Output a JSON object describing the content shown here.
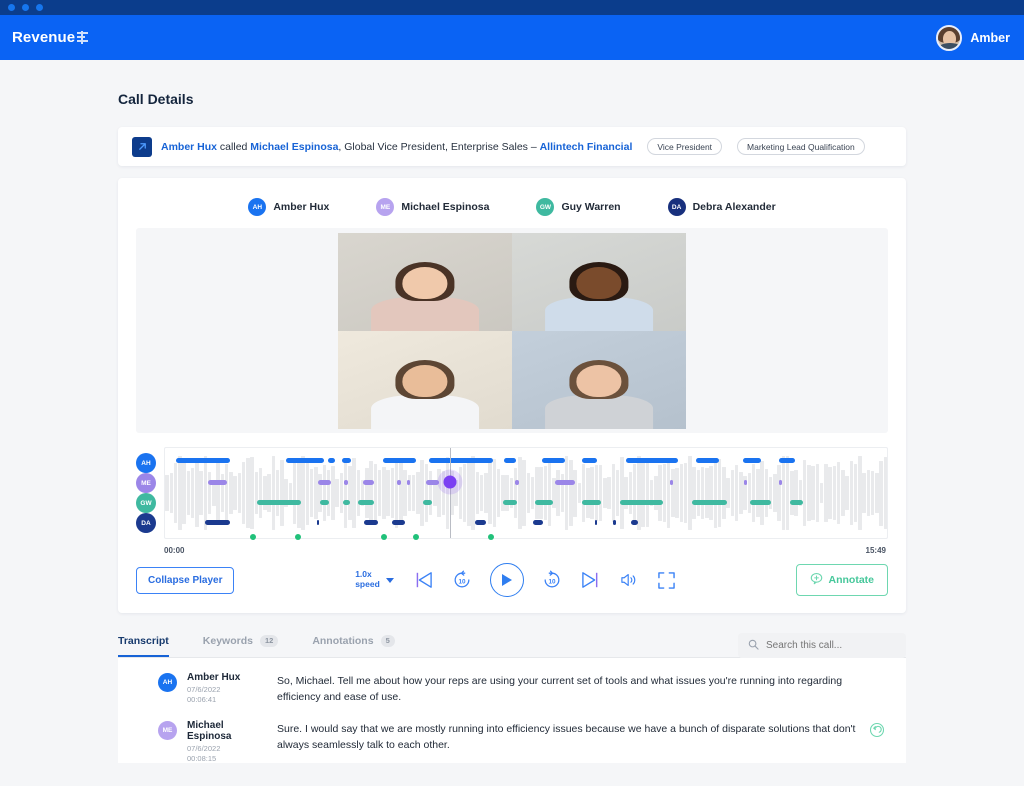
{
  "window": {
    "dots": 3
  },
  "topnav": {
    "brand": "Revenue",
    "brand_icon": "revenue-logo-mark",
    "user_name": "Amber",
    "avatar_icon": "user-avatar"
  },
  "page": {
    "title": "Call Details"
  },
  "summary": {
    "icon": "call-arrow-icon",
    "caller": "Amber Hux",
    "verb": " called ",
    "callee": "Michael Espinosa",
    "role": ", Global Vice President, Enterprise Sales – ",
    "org": "Allintech Financial",
    "tags": [
      "Vice President",
      "Marketing Lead Qualification"
    ]
  },
  "participants": [
    {
      "initials": "AH",
      "name": "Amber Hux",
      "color": "#1a73f0"
    },
    {
      "initials": "ME",
      "name": "Michael Espinosa",
      "color": "#b7a3ef"
    },
    {
      "initials": "GW",
      "name": "Guy Warren",
      "color": "#3fb9a0"
    },
    {
      "initials": "DA",
      "name": "Debra Alexander",
      "color": "#18307d"
    }
  ],
  "video_grid": {
    "tiles": [
      {
        "name": "participant-video-top-left",
        "bg": "#d9d6cf",
        "skin": "#f0c9ab",
        "hair": "#4a3326",
        "shirt": "#e3c7bd"
      },
      {
        "name": "participant-video-top-right",
        "bg": "#d7d9d6",
        "skin": "#7a4b2c",
        "hair": "#2a1a12",
        "shirt": "#cfdcea"
      },
      {
        "name": "participant-video-bottom-left",
        "bg": "#efe9dd",
        "skin": "#e9bd99",
        "hair": "#5d4634",
        "shirt": "#f4f5f7"
      },
      {
        "name": "participant-video-bottom-right",
        "bg": "#c3cfdb",
        "skin": "#edc3a5",
        "hair": "#6b513c",
        "shirt": "#cfd2d6"
      }
    ]
  },
  "timeline": {
    "start_time": "00:00",
    "end_time": "15:49",
    "playhead_percent": 39.5,
    "playhead_track": 1,
    "tracks": [
      {
        "initials": "AH",
        "color": "#1a73f0",
        "segments": [
          [
            1.5,
            7.5
          ],
          [
            16.8,
            5.2
          ],
          [
            22.6,
            1.0
          ],
          [
            24.5,
            1.2
          ],
          [
            30.2,
            4.5
          ],
          [
            36.5,
            9.0
          ],
          [
            47.0,
            1.6
          ],
          [
            52.2,
            3.2
          ],
          [
            57.8,
            2.0
          ],
          [
            63.8,
            7.2
          ],
          [
            73.5,
            3.2
          ],
          [
            80.0,
            2.6
          ],
          [
            85.0,
            2.2
          ]
        ]
      },
      {
        "initials": "ME",
        "color": "#9b86e8",
        "segments": [
          [
            6.0,
            2.6
          ],
          [
            21.2,
            1.8
          ],
          [
            24.8,
            0.5
          ],
          [
            27.4,
            1.6
          ],
          [
            32.2,
            0.5
          ],
          [
            33.5,
            0.5
          ],
          [
            36.2,
            1.8
          ],
          [
            48.5,
            0.5
          ],
          [
            54.0,
            2.8
          ],
          [
            70.0,
            0.4
          ],
          [
            80.2,
            0.4
          ],
          [
            85.0,
            0.4
          ]
        ]
      },
      {
        "initials": "GW",
        "color": "#3fb9a0",
        "segments": [
          [
            12.8,
            6.0
          ],
          [
            21.5,
            1.2
          ],
          [
            24.6,
            1.0
          ],
          [
            26.8,
            2.2
          ],
          [
            35.8,
            1.2
          ],
          [
            46.8,
            2.0
          ],
          [
            51.2,
            2.6
          ],
          [
            57.8,
            2.6
          ],
          [
            63.0,
            6.0
          ],
          [
            73.0,
            4.8
          ],
          [
            81.0,
            3.0
          ],
          [
            86.5,
            1.8
          ]
        ]
      },
      {
        "initials": "DA",
        "color": "#1b3a8f",
        "segments": [
          [
            5.5,
            3.5
          ],
          [
            21.0,
            0.4
          ],
          [
            27.5,
            2.0
          ],
          [
            31.5,
            1.8
          ],
          [
            43.0,
            1.4
          ],
          [
            51.0,
            1.4
          ],
          [
            59.5,
            0.4
          ],
          [
            62.0,
            0.4
          ],
          [
            64.5,
            1.0
          ]
        ]
      }
    ],
    "markers": [
      11.8,
      17.8,
      29.2,
      33.5,
      43.5
    ]
  },
  "controls": {
    "collapse_label": "Collapse Player",
    "speed_value": "1.0x",
    "speed_label": "speed",
    "prev_icon": "skip-previous-icon",
    "rewind_icon": "rewind-10-icon",
    "play_icon": "play-icon",
    "forward_icon": "forward-10-icon",
    "next_icon": "skip-next-icon",
    "volume_icon": "volume-icon",
    "fullscreen_icon": "fullscreen-icon",
    "annotate_label": "Annotate",
    "annotate_icon": "annotate-icon"
  },
  "tabs": [
    {
      "label": "Transcript",
      "badge": "",
      "active": true
    },
    {
      "label": "Keywords",
      "badge": "12",
      "active": false
    },
    {
      "label": "Annotations",
      "badge": "5",
      "active": false
    }
  ],
  "search": {
    "placeholder": "Search this call...",
    "value": "",
    "icon": "search-icon"
  },
  "transcript": [
    {
      "initials": "AH",
      "color": "#1a73f0",
      "name": "Amber Hux",
      "date": "07/6/2022",
      "time": "00:06:41",
      "text": "So, Michael. Tell me about how your reps are using your current set of tools and what issues you're running into regarding efficiency and ease of use.",
      "has_reply": false
    },
    {
      "initials": "ME",
      "color": "#b7a3ef",
      "name": "Michael Espinosa",
      "date": "07/6/2022",
      "time": "00:08:15",
      "text": "Sure. I would say that we are mostly running into efficiency issues because we have a bunch of disparate solutions that don't always seamlessly talk to each other.",
      "has_reply": true,
      "reply_icon": "reply-icon"
    }
  ],
  "colors": {
    "titlebar": "#0b3d8c",
    "topnav": "#0a63f4",
    "page_bg": "#f5f6f8",
    "accent_blue": "#1763d6",
    "accent_green": "#45c79a",
    "playhead_purple": "#7b3ff2"
  }
}
